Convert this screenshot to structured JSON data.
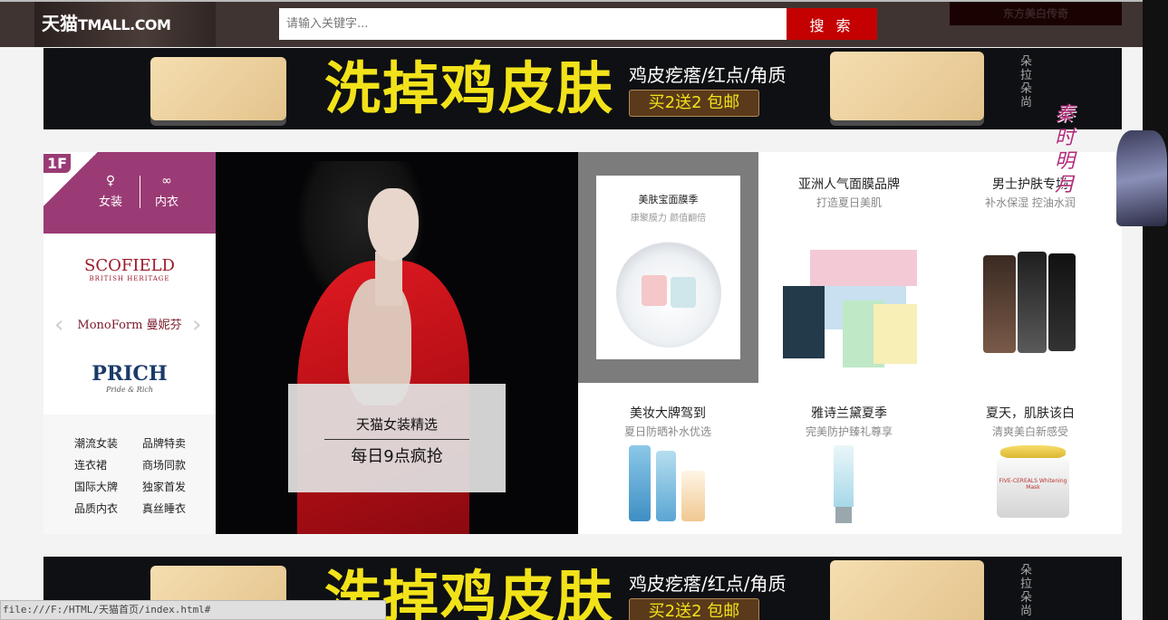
{
  "header": {
    "logo_main": "天猫",
    "logo_sub": "TMALL.COM",
    "search_placeholder": "请输入关键字...",
    "search_button": "搜 索",
    "top_ad_text": "东方美白传奇"
  },
  "banner": {
    "slogan": "洗掉鸡皮肤",
    "subtitle": "鸡皮疙瘩/红点/角质",
    "promo": "买2送2  包邮",
    "brand_vertical": "朵拉朵尚"
  },
  "floor": {
    "number": "1F",
    "categories": [
      {
        "label": "女装",
        "icon": "dress-icon"
      },
      {
        "label": "内衣",
        "icon": "bra-icon"
      }
    ],
    "brands": {
      "scofield": "SCOFIELD",
      "scofield_sub": "BRITISH HERITAGE",
      "monoform": "MonoForm 曼妮芬",
      "prich": "PRICH",
      "prich_sub": "Pride & Rich"
    },
    "links": [
      "潮流女装",
      "品牌特卖",
      "连衣裙",
      "商场同款",
      "国际大牌",
      "独家首发",
      "品质内衣",
      "真丝睡衣"
    ],
    "model_caption_title": "天猫女装精选",
    "model_caption_sub": "每日9点疯抢"
  },
  "products": {
    "feature": {
      "title": "美肤宝面膜季",
      "subtitle": "康聚膜力  颜值翻倍"
    },
    "cells": [
      {
        "title": "亚洲人气面膜品牌",
        "subtitle": "打造夏日美肌"
      },
      {
        "title": "男士护肤专场",
        "subtitle": "补水保湿 控油水润"
      },
      {
        "title": "美妆大牌驾到",
        "subtitle": "夏日防晒补水优选"
      },
      {
        "title": "雅诗兰黛夏季",
        "subtitle": "完美防护臻礼尊享"
      },
      {
        "title": "夏天，肌肤该白",
        "subtitle": "清爽美白新感受"
      }
    ],
    "cream_label": "FIVE-CEREALS\nWhitening Mask"
  },
  "side_deco": {
    "text": "秦时明月"
  },
  "statusbar": {
    "url": "file:///F:/HTML/天猫首页/index.html#"
  }
}
